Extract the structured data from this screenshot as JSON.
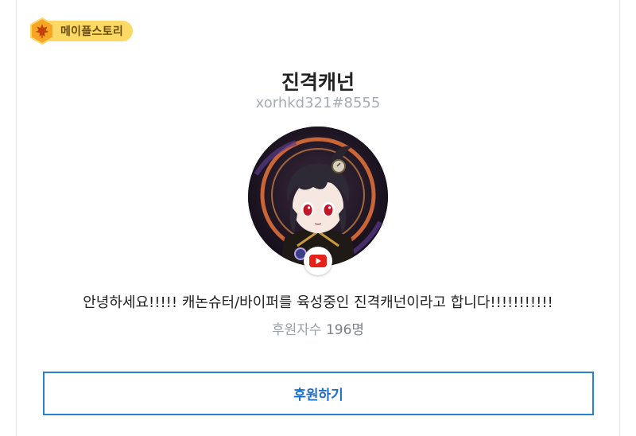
{
  "game_tag": {
    "label": "메이플스토리",
    "icon": "maple-leaf-icon",
    "color": "#fcd865"
  },
  "profile": {
    "name": "진격캐넌",
    "handle": "xorhkd321#8555",
    "avatar": "avatar-image",
    "platform_icon": "youtube-icon",
    "bio": "안녕하세요!!!!! 캐논슈터/바이퍼를 육성중인 진격캐넌이라고 합니다!!!!!!!!!!!",
    "supporters_label": "후원자수",
    "supporters_count": "196명"
  },
  "actions": {
    "support_label": "후원하기"
  },
  "colors": {
    "accent": "#2a7fd3",
    "youtube": "#e62117"
  }
}
